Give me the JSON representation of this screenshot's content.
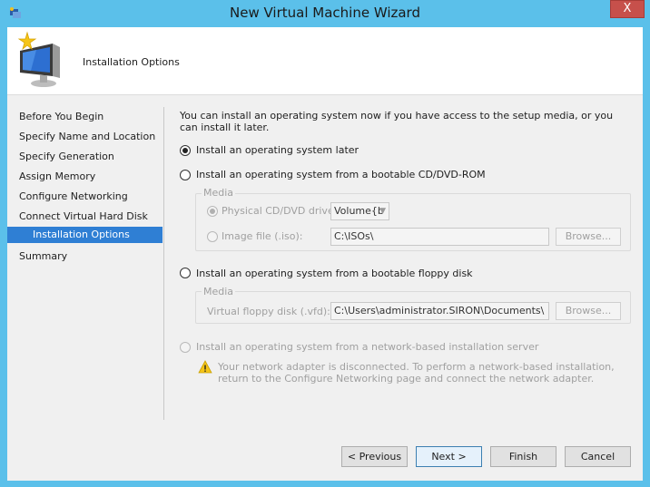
{
  "window": {
    "title": "New Virtual Machine Wizard",
    "close_label": "X"
  },
  "header": {
    "title": "Installation Options"
  },
  "nav": {
    "items": [
      {
        "label": "Before You Begin"
      },
      {
        "label": "Specify Name and Location"
      },
      {
        "label": "Specify Generation"
      },
      {
        "label": "Assign Memory"
      },
      {
        "label": "Configure Networking"
      },
      {
        "label": "Connect Virtual Hard Disk"
      },
      {
        "label": "Installation Options",
        "active": true
      },
      {
        "label": "Summary"
      }
    ]
  },
  "content": {
    "intro": "You can install an operating system now if you have access to the setup media, or you can install it later.",
    "option_later": {
      "label": "Install an operating system later",
      "selected": true
    },
    "option_cd": {
      "label": "Install an operating system from a bootable CD/DVD-ROM",
      "selected": false
    },
    "cd_media": {
      "group_title": "Media",
      "physical_label": "Physical CD/DVD drive:",
      "physical_value": "Volume{b",
      "image_label": "Image file (.iso):",
      "image_value": "C:\\ISOs\\",
      "browse_label": "Browse..."
    },
    "option_floppy": {
      "label": "Install an operating system from a bootable floppy disk",
      "selected": false
    },
    "floppy_media": {
      "group_title": "Media",
      "vfd_label": "Virtual floppy disk (.vfd):",
      "vfd_value": "C:\\Users\\administrator.SIRON\\Documents\\",
      "browse_label": "Browse..."
    },
    "option_network": {
      "label": "Install an operating system from a network-based installation server",
      "selected": false
    },
    "network_warning": "Your network adapter is disconnected. To perform a network-based installation, return to the Configure Networking page and connect the network adapter."
  },
  "footer": {
    "previous_label": "< Previous",
    "next_label": "Next >",
    "finish_label": "Finish",
    "cancel_label": "Cancel"
  }
}
